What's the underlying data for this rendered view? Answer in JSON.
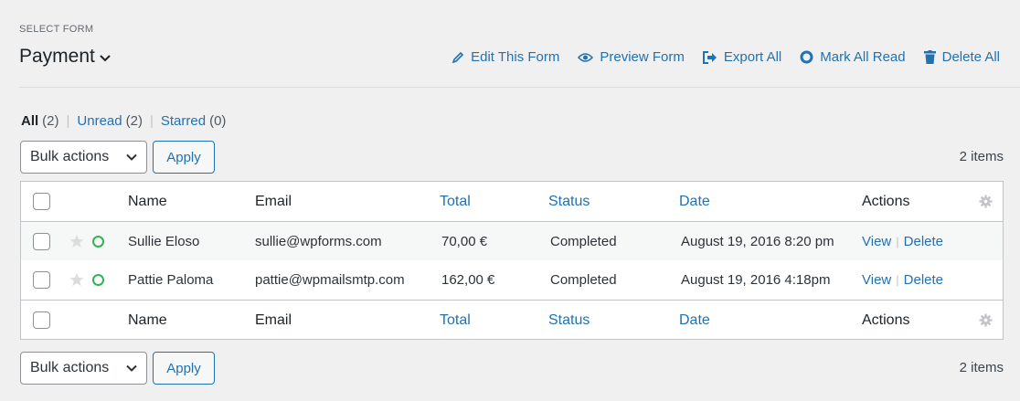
{
  "header": {
    "select_label": "SELECT FORM",
    "form_name": "Payment",
    "tools": [
      {
        "label": "Edit This Form",
        "icon": "pencil-icon"
      },
      {
        "label": "Preview Form",
        "icon": "eye-icon"
      },
      {
        "label": "Export All",
        "icon": "export-icon"
      },
      {
        "label": "Mark All Read",
        "icon": "circle-icon"
      },
      {
        "label": "Delete All",
        "icon": "trash-icon"
      }
    ]
  },
  "filters": {
    "all": {
      "label": "All",
      "count": "(2)"
    },
    "unread": {
      "label": "Unread",
      "count": "(2)"
    },
    "starred": {
      "label": "Starred",
      "count": "(0)"
    }
  },
  "bulk": {
    "select_value": "Bulk actions",
    "apply_label": "Apply",
    "items_count": "2 items"
  },
  "table": {
    "columns": {
      "name": "Name",
      "email": "Email",
      "total": "Total",
      "status": "Status",
      "date": "Date",
      "actions": "Actions"
    },
    "rows": [
      {
        "name": "Sullie Eloso",
        "email": "sullie@wpforms.com",
        "total": "70,00 €",
        "status": "Completed",
        "date": "August 19, 2016 8:20 pm",
        "view": "View",
        "delete": "Delete"
      },
      {
        "name": "Pattie Paloma",
        "email": "pattie@wpmailsmtp.com",
        "total": "162,00 €",
        "status": "Completed",
        "date": "August 19, 2016 4:18pm",
        "view": "View",
        "delete": "Delete"
      }
    ]
  },
  "colors": {
    "link": "#2271b1",
    "unread_dot": "#30b450",
    "background": "#f0f0f1"
  }
}
